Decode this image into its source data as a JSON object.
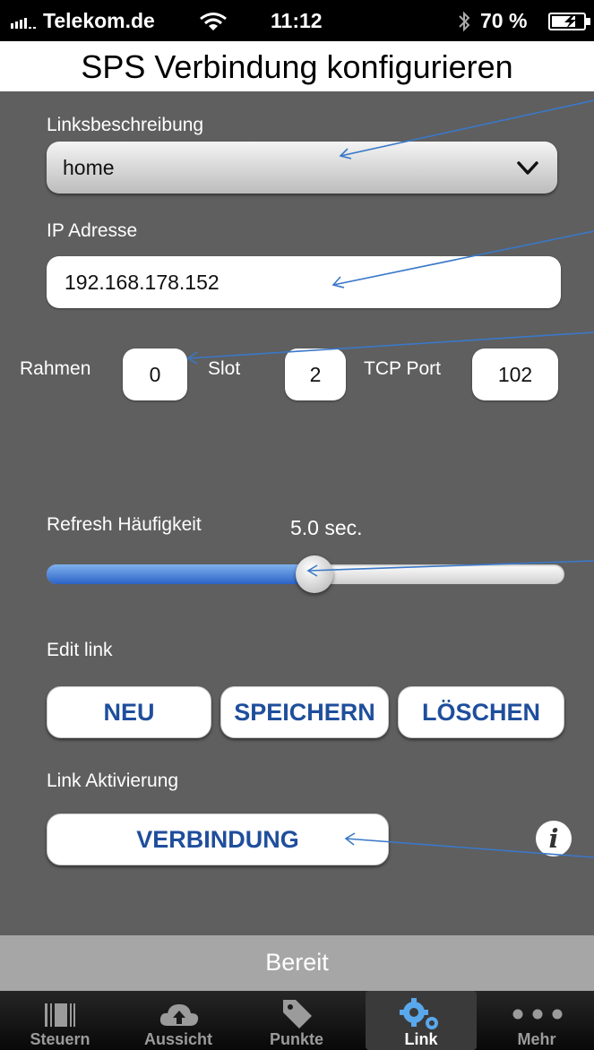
{
  "status_bar": {
    "carrier": "Telekom.de",
    "time": "11:12",
    "battery": "70 %"
  },
  "title": "SPS Verbindung konfigurieren",
  "link_description": {
    "label": "Linksbeschreibung",
    "value": "home"
  },
  "ip": {
    "label": "IP Adresse",
    "value": "192.168.178.152"
  },
  "rack": {
    "label": "Rahmen",
    "value": "0"
  },
  "slot": {
    "label": "Slot",
    "value": "2"
  },
  "tcp_port": {
    "label": "TCP Port",
    "value": "102"
  },
  "refresh": {
    "label": "Refresh Häufigkeit",
    "value_text": "5.0 sec.",
    "slider_fraction": 0.5
  },
  "edit": {
    "label": "Edit link",
    "new": "NEU",
    "save": "SPEICHERN",
    "delete": "LÖSCHEN"
  },
  "activation": {
    "label": "Link Aktivierung",
    "connect": "VERBINDUNG"
  },
  "info_glyph": "i",
  "status_text": "Bereit",
  "tabs": [
    {
      "label": "Steuern",
      "icon": "barcode-icon"
    },
    {
      "label": "Aussicht",
      "icon": "cloud-upload-icon"
    },
    {
      "label": "Punkte",
      "icon": "tag-icon"
    },
    {
      "label": "Link",
      "icon": "gears-icon",
      "active": true
    },
    {
      "label": "Mehr",
      "icon": "more-dots-icon"
    }
  ],
  "colors": {
    "background": "#5f5f5f",
    "button_text": "#1f4e9c",
    "arrow": "#3a78c9",
    "slider_fill": "#2b63c6"
  }
}
